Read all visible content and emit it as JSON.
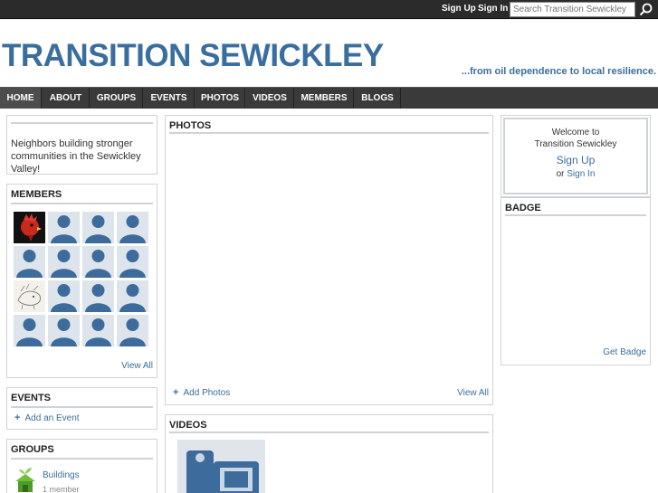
{
  "userbar": {
    "sign_up": "Sign Up",
    "sign_in": "Sign In",
    "search_placeholder": "Search Transition Sewickley"
  },
  "header": {
    "title": "TRANSITION SEWICKLEY",
    "tagline": "...from oil dependence to local resilience."
  },
  "nav": {
    "items": [
      "HOME",
      "ABOUT",
      "GROUPS",
      "EVENTS",
      "PHOTOS",
      "VIDEOS",
      "MEMBERS",
      "BLOGS"
    ],
    "active": "HOME"
  },
  "left": {
    "intro": "Neighbors building stronger communities in the Sewickley Valley!",
    "members_title": "MEMBERS",
    "members_view_all": "View All",
    "events_title": "EVENTS",
    "events_add": "Add an Event",
    "groups_title": "GROUPS",
    "group_name": "Buildings",
    "group_count": "1 member"
  },
  "center": {
    "photos_title": "PHOTOS",
    "photos_add": "Add Photos",
    "photos_view_all": "View All",
    "videos_title": "VIDEOS"
  },
  "right": {
    "welcome_line1": "Welcome to",
    "welcome_line2": "Transition Sewickley",
    "sign_up": "Sign Up",
    "or": "or",
    "sign_in": "Sign In",
    "badge_title": "BADGE",
    "get_badge": "Get Badge"
  },
  "colors": {
    "brand_blue": "#3a6e9e",
    "nav_bg": "#3a3a3a",
    "userbar_bg": "#2b2b2b"
  }
}
